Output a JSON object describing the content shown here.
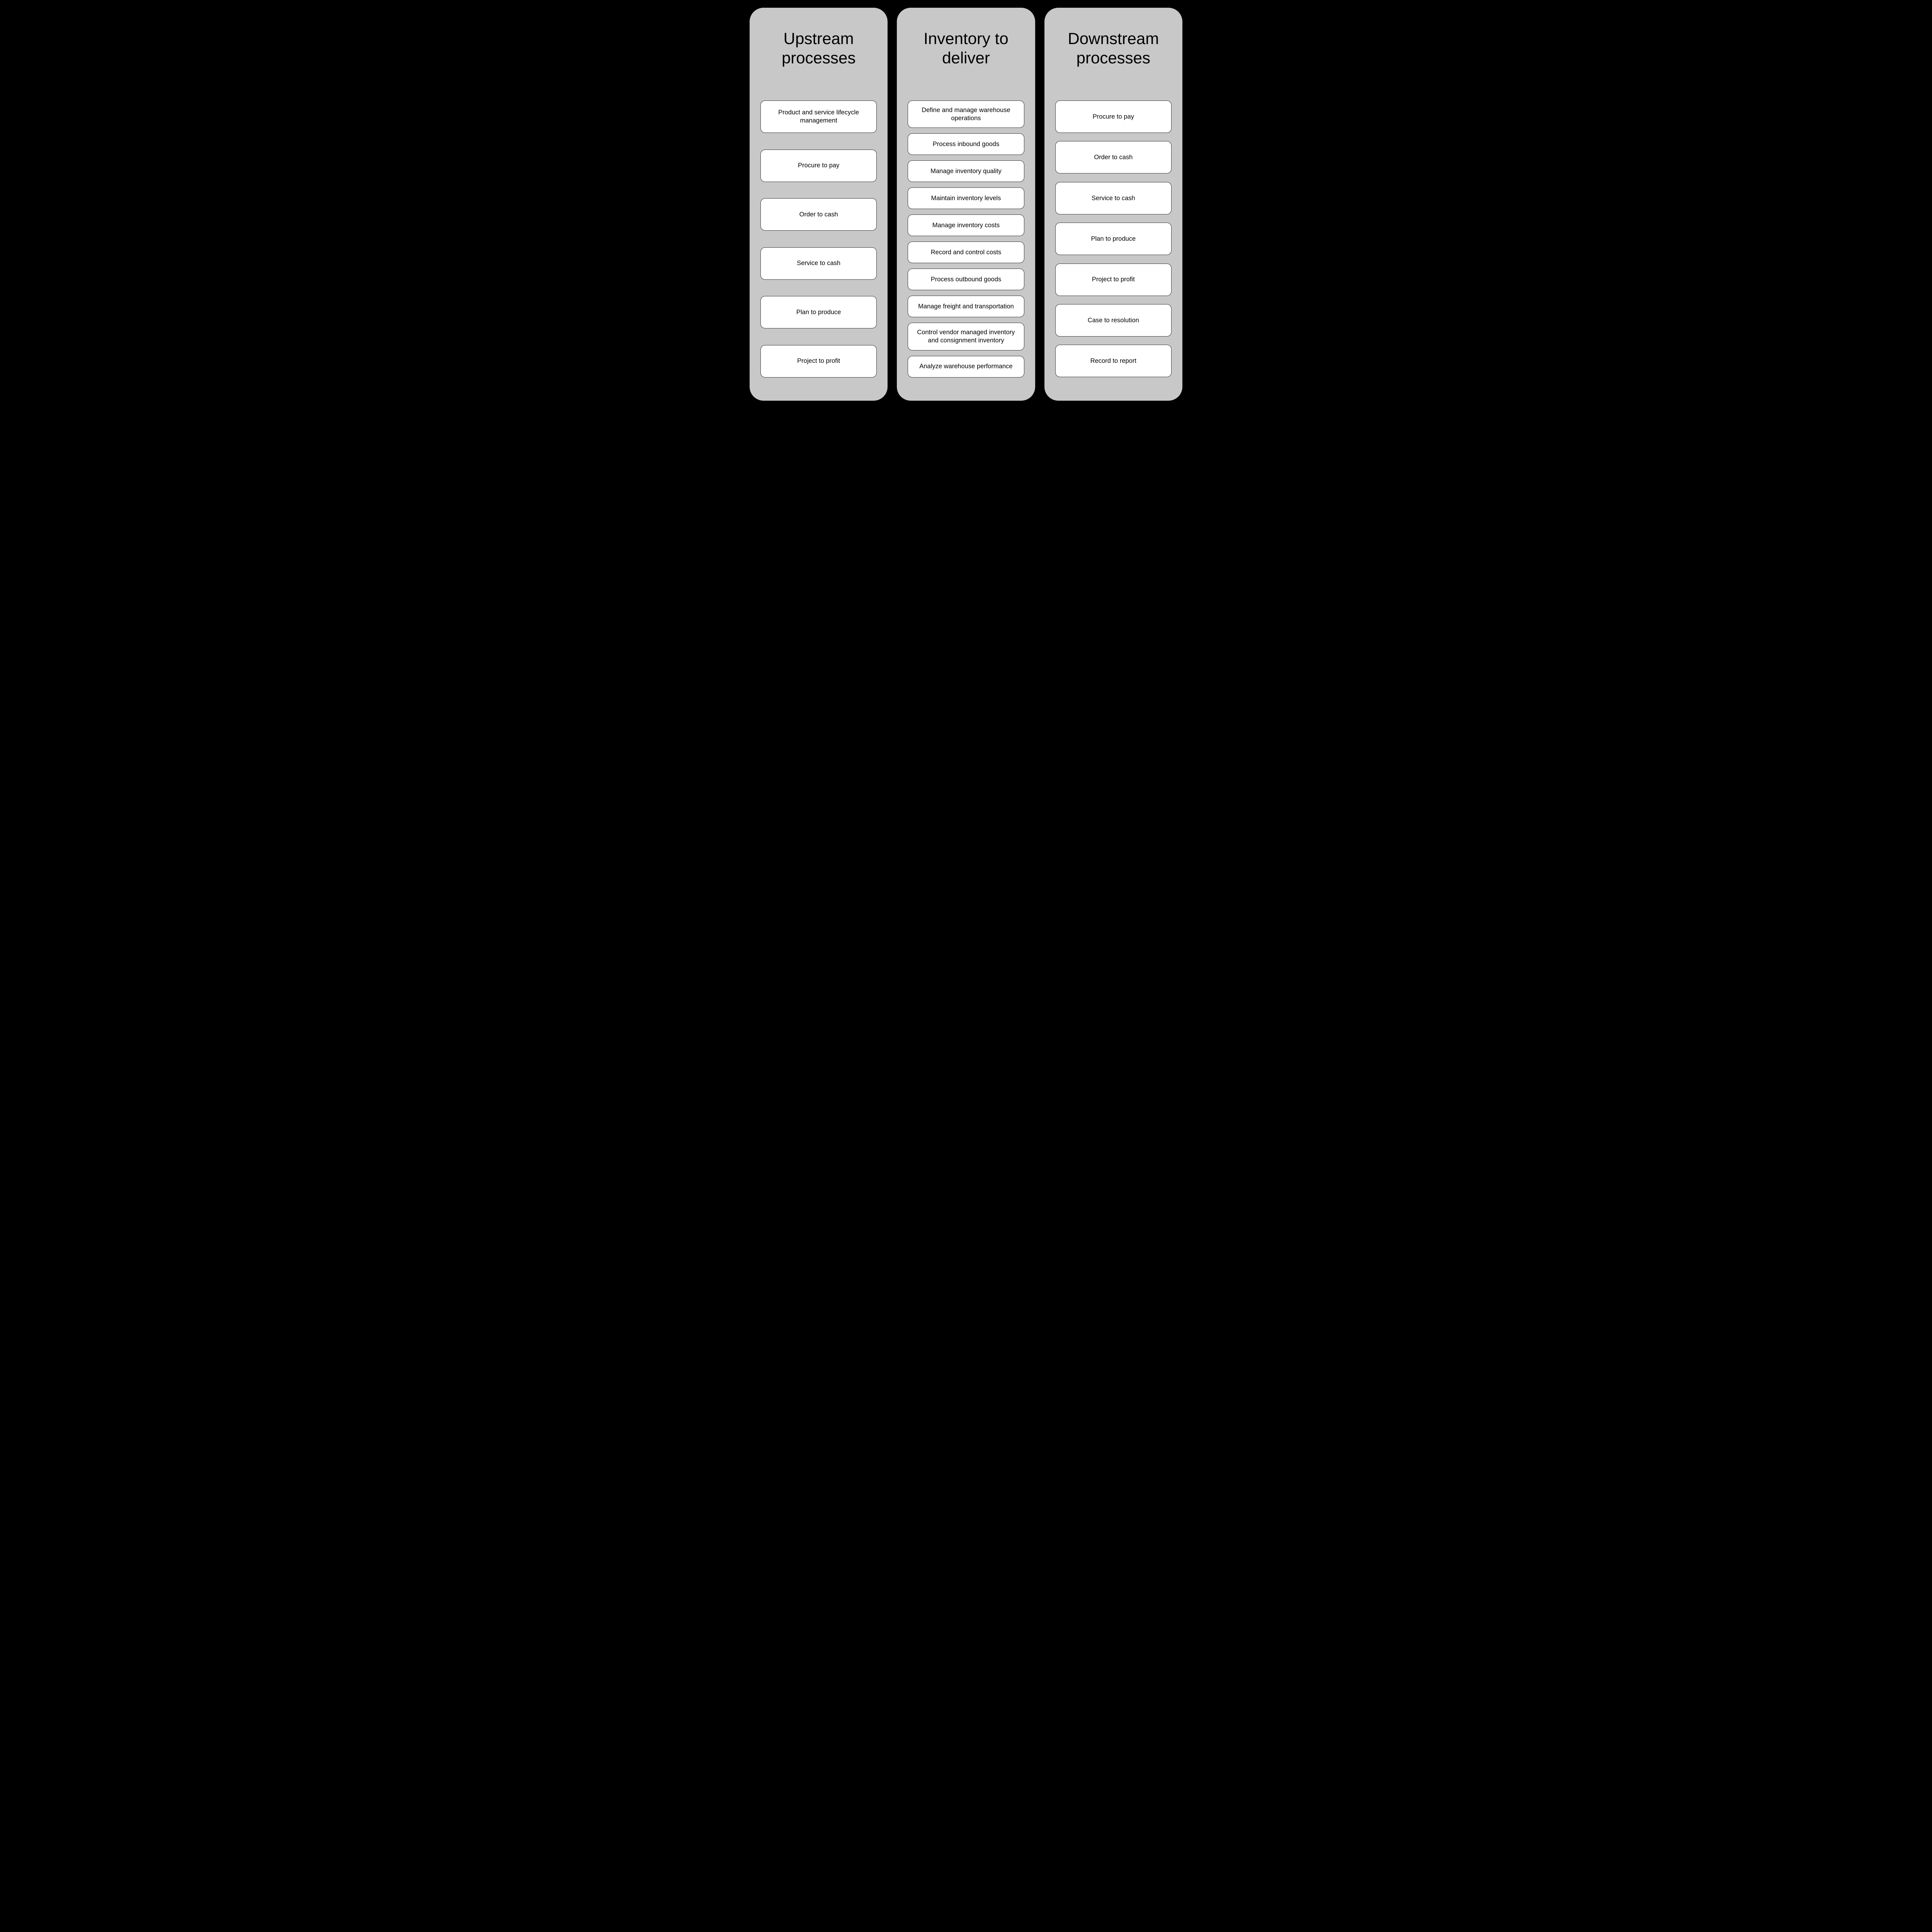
{
  "columns": [
    {
      "title": "Upstream processes",
      "spread": true,
      "tallItems": true,
      "items": [
        "Product and service lifecycle management",
        "Procure to pay",
        "Order to cash",
        "Service to cash",
        "Plan to produce",
        "Project to profit"
      ]
    },
    {
      "title": "Inventory to deliver",
      "spread": false,
      "tallItems": false,
      "items": [
        "Define and manage warehouse operations",
        "Process inbound goods",
        "Manage inventory quality",
        "Maintain inventory levels",
        "Manage inventory costs",
        "Record and control costs",
        "Process outbound goods",
        "Manage freight and transportation",
        "Control vendor managed inventory and consignment inventory",
        "Analyze warehouse performance"
      ]
    },
    {
      "title": "Downstream processes",
      "spread": true,
      "tallItems": true,
      "items": [
        "Procure to pay",
        "Order to cash",
        "Service to cash",
        "Plan to produce",
        "Project to profit",
        "Case to resolution",
        "Record to report"
      ]
    }
  ]
}
